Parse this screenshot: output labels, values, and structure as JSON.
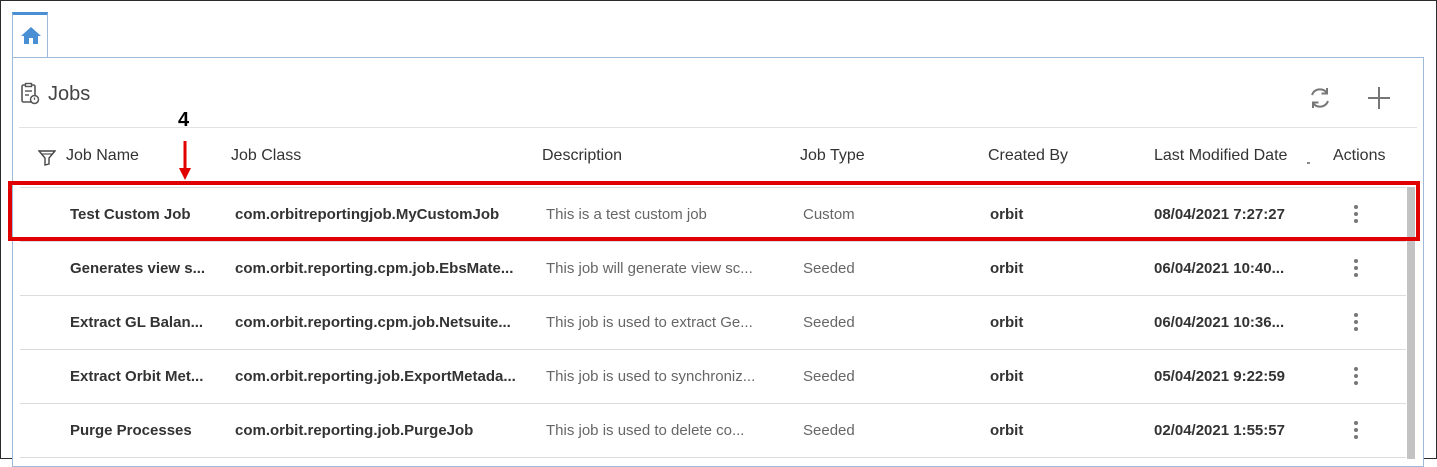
{
  "tabs": {
    "home_icon": "home-icon"
  },
  "panel": {
    "title": "Jobs",
    "title_icon": "clipboard-icon",
    "refresh_icon": "refresh-icon",
    "add_icon": "plus-icon"
  },
  "table": {
    "columns": [
      "Job Name",
      "Job Class",
      "Description",
      "Job Type",
      "Created By",
      "Last Modified Date",
      "Actions"
    ],
    "rows": [
      {
        "job_name": "Test Custom Job",
        "job_class": "com.orbitreportingjob.MyCustomJob",
        "description": "This is a test custom job",
        "job_type": "Custom",
        "created_by": "orbit",
        "last_modified": "08/04/2021 7:27:27"
      },
      {
        "job_name": "Generates view s...",
        "job_class": "com.orbit.reporting.cpm.job.EbsMate...",
        "description": "This job will generate view sc...",
        "job_type": "Seeded",
        "created_by": "orbit",
        "last_modified": "06/04/2021 10:40..."
      },
      {
        "job_name": "Extract GL Balan...",
        "job_class": "com.orbit.reporting.cpm.job.Netsuite...",
        "description": "This job is used to extract Ge...",
        "job_type": "Seeded",
        "created_by": "orbit",
        "last_modified": "06/04/2021 10:36..."
      },
      {
        "job_name": "Extract Orbit Met...",
        "job_class": "com.orbit.reporting.job.ExportMetada...",
        "description": "This job is used to synchroniz...",
        "job_type": "Seeded",
        "created_by": "orbit",
        "last_modified": "05/04/2021 9:22:59"
      },
      {
        "job_name": "Purge Processes",
        "job_class": "com.orbit.reporting.job.PurgeJob",
        "description": "This job is used to delete co...",
        "job_type": "Seeded",
        "created_by": "orbit",
        "last_modified": "02/04/2021 1:55:57"
      }
    ]
  },
  "annotation": {
    "number": "4"
  },
  "colors": {
    "highlight": "#e00000",
    "tab_accent": "#4a8fd3",
    "panel_border": "#9dbbd9"
  }
}
